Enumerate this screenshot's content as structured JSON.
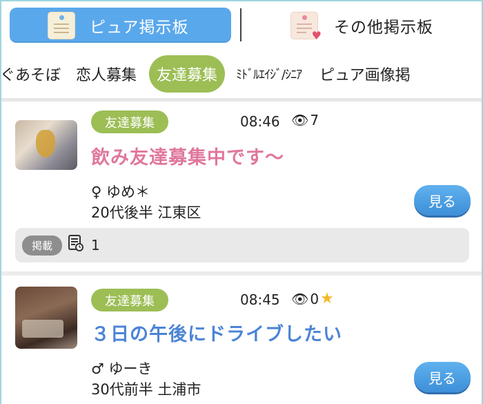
{
  "boards": {
    "active_label": "ピュア掲示板",
    "inactive_label": "その他掲示板"
  },
  "categories": [
    "ぐあそぼ",
    "恋人募集",
    "友達募集",
    "ﾐﾄﾞﾙｴｲｼﾞ/ｼﾆｱ",
    "ピュア画像掲"
  ],
  "posts": [
    {
      "badge": "友達募集",
      "time": "08:46",
      "views": "7",
      "title": "飲み友達募集中です〜",
      "user": "♀ ゆめ＊",
      "meta": "20代後半 江東区",
      "view_button": "見る",
      "listing_label": "掲載",
      "listing_count": "1"
    },
    {
      "badge": "友達募集",
      "time": "08:45",
      "views": "0",
      "title": "３日の午後にドライブしたい",
      "user": "♂ ゆーき",
      "meta": "30代前半 土浦市",
      "view_button": "見る"
    }
  ],
  "colors": {
    "active_board": "#5aa8ec",
    "category_active": "#9cbe55",
    "badge": "#9cbe55",
    "title_female": "#e0779d",
    "title_male": "#4c84d6",
    "view_button": "#4a9de2"
  },
  "icons": {
    "board_icon": "notice-board-icon",
    "other_board_icon": "notice-heart-icon",
    "views": "eye-icon",
    "favorite": "star-icon",
    "listing": "document-clock-icon"
  }
}
